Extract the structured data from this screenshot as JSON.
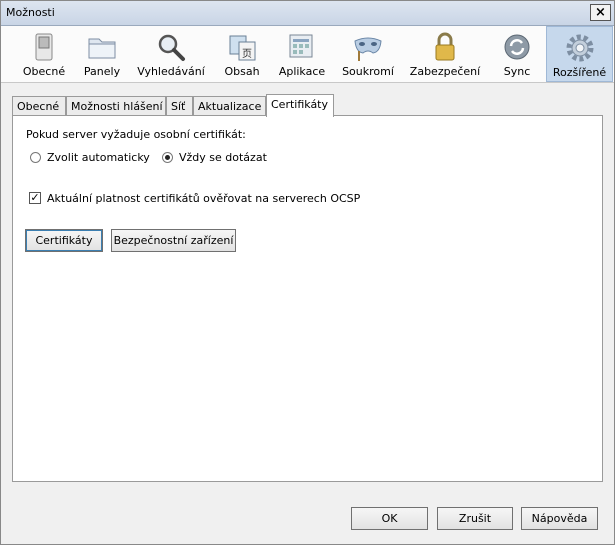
{
  "window": {
    "title": "Možnosti",
    "close_label": "×"
  },
  "toolbar": {
    "items": [
      {
        "label": "Obecné",
        "icon": "general-switch-icon"
      },
      {
        "label": "Panely",
        "icon": "tabs-folder-icon"
      },
      {
        "label": "Vyhledávání",
        "icon": "magnifier-icon"
      },
      {
        "label": "Obsah",
        "icon": "content-icon"
      },
      {
        "label": "Aplikace",
        "icon": "applications-icon"
      },
      {
        "label": "Soukromí",
        "icon": "privacy-mask-icon"
      },
      {
        "label": "Zabezpečení",
        "icon": "padlock-icon"
      },
      {
        "label": "Sync",
        "icon": "sync-icon"
      },
      {
        "label": "Rozšířené",
        "icon": "advanced-gear-icon",
        "selected": true
      }
    ]
  },
  "tabs": [
    {
      "label": "Obecné"
    },
    {
      "label": "Možnosti hlášení"
    },
    {
      "label": "Síť"
    },
    {
      "label": "Aktualizace"
    },
    {
      "label": "Certifikáty",
      "active": true
    }
  ],
  "certificates": {
    "prompt": "Pokud server vyžaduje osobní certifikát:",
    "radio_auto": "Zvolit automaticky",
    "radio_ask": "Vždy se dotázat",
    "selected": "Vždy se dotázat",
    "ocsp_label": "Aktuální platnost certifikátů ověřovat na serverech OCSP",
    "ocsp_checked": true,
    "certificates_button": "Certifikáty",
    "security_devices_button": "Bezpečnostní zařízení"
  },
  "footer": {
    "ok": "OK",
    "cancel": "Zrušit",
    "help": "Nápověda"
  },
  "colors": {
    "selected_bg": "#c6d8ec",
    "titlebar": "#d3ddea"
  }
}
